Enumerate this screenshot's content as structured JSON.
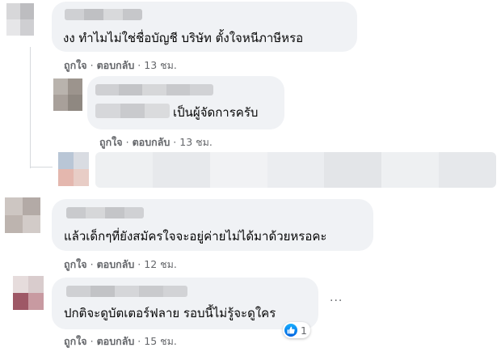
{
  "comments": [
    {
      "text": "งง ทำไมไม่ใช่ชื่อบัญชี บริษัท ตั้งใจหนีภาษีหรอ",
      "actions": {
        "like": "ถูกใจ",
        "reply": "ตอบกลับ",
        "time": "13 ชม."
      }
    },
    {
      "text": "เป็นผู้จัดการครับ",
      "actions": {
        "like": "ถูกใจ",
        "reply": "ตอบกลับ",
        "time": "13 ชม."
      }
    },
    {
      "text": "แล้วเด็กๆที่ยังสมัครใจจะอยู่ค่ายไม่ได้มาด้วยหรอคะ",
      "actions": {
        "like": "ถูกใจ",
        "reply": "ตอบกลับ",
        "time": "12 ชม."
      }
    },
    {
      "text": "ปกติจะดูบัตเตอร์ฟลาย รอบนี้ไม่รู้จะดูใคร",
      "actions": {
        "like": "ถูกใจ",
        "reply": "ตอบกลับ",
        "time": "15 ชม."
      },
      "more": "···",
      "reaction": {
        "icon": "like-icon",
        "count": "1"
      }
    }
  ],
  "separator": "·",
  "colors": {
    "bubble": "#f0f2f5",
    "secondary": "#65676b",
    "like_blue": "#1877f2"
  }
}
